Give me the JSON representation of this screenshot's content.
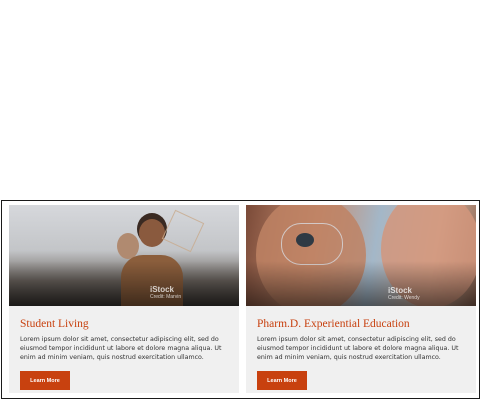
{
  "cards": [
    {
      "title": "Student Living",
      "description": "Lorem ipsum dolor sit amet, consectetur adipiscing elit, sed do eiusmod tempor incididunt ut labore et dolore magna aliqua. Ut enim ad minim veniam, quis nostrud exercitation ullamco.",
      "button_label": "Learn More",
      "photo_watermark": "iStock",
      "photo_credit": "Credit: Marvin"
    },
    {
      "title": "Pharm.D. Experiential Education",
      "description": "Lorem ipsum dolor sit amet, consectetur adipiscing elit, sed do eiusmod tempor incididunt ut labore et dolore magna aliqua. Ut enim ad minim veniam, quis nostrud exercitation ullamco.",
      "button_label": "Learn More",
      "photo_watermark": "iStock",
      "photo_credit": "Credit: Wendy"
    }
  ],
  "colors": {
    "accent": "#c8410f",
    "card_background": "#f0f0f0",
    "border": "#1a1a1a"
  }
}
